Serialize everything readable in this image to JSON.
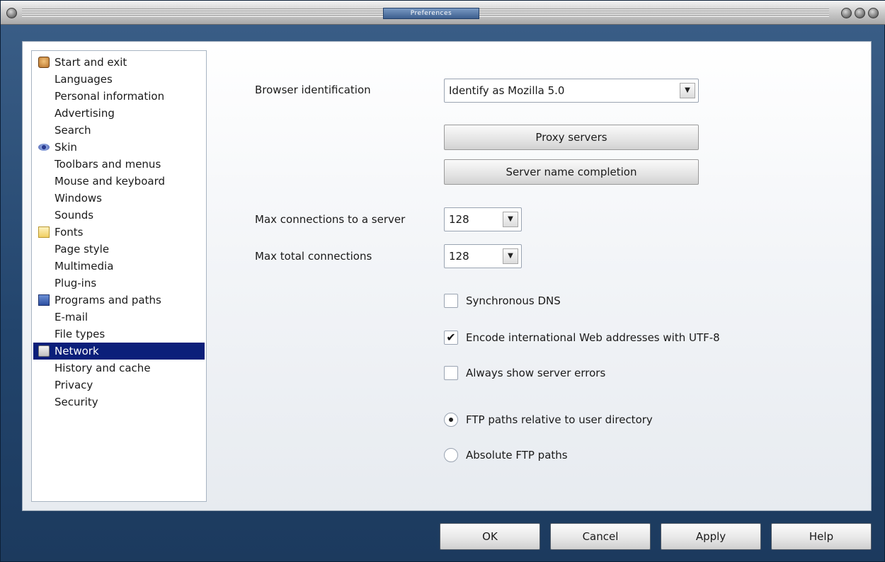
{
  "window": {
    "title": "Preferences"
  },
  "sidebar": {
    "items": [
      {
        "label": "Start and exit",
        "icon": "face-icon"
      },
      {
        "label": "Languages"
      },
      {
        "label": "Personal information"
      },
      {
        "label": "Advertising"
      },
      {
        "label": "Search"
      },
      {
        "label": "Skin",
        "icon": "eye-icon"
      },
      {
        "label": "Toolbars and menus"
      },
      {
        "label": "Mouse and keyboard"
      },
      {
        "label": "Windows"
      },
      {
        "label": "Sounds"
      },
      {
        "label": "Fonts",
        "icon": "folder-icon"
      },
      {
        "label": "Page style"
      },
      {
        "label": "Multimedia"
      },
      {
        "label": "Plug-ins"
      },
      {
        "label": "Programs and paths",
        "icon": "disk-icon"
      },
      {
        "label": "E-mail"
      },
      {
        "label": "File types"
      },
      {
        "label": "Network",
        "icon": "lock-icon",
        "selected": true
      },
      {
        "label": "History and cache"
      },
      {
        "label": "Privacy"
      },
      {
        "label": "Security"
      }
    ]
  },
  "network": {
    "browser_identification_label": "Browser identification",
    "browser_identification_value": "Identify as Mozilla 5.0",
    "proxy_servers_button": "Proxy servers",
    "server_name_completion_button": "Server name completion",
    "max_connections_server_label": "Max connections to a server",
    "max_connections_server_value": "128",
    "max_total_connections_label": "Max total connections",
    "max_total_connections_value": "128",
    "synchronous_dns_label": "Synchronous DNS",
    "synchronous_dns_checked": false,
    "encode_utf8_label": "Encode international Web addresses with UTF-8",
    "encode_utf8_checked": true,
    "always_show_errors_label": "Always show server errors",
    "always_show_errors_checked": false,
    "ftp_relative_label": "FTP paths relative to user directory",
    "ftp_absolute_label": "Absolute FTP paths",
    "ftp_selected": "relative"
  },
  "footer": {
    "ok_label": "OK",
    "cancel_label": "Cancel",
    "apply_label": "Apply",
    "help_label": "Help"
  },
  "colors": {
    "selection": "#0b1f7a",
    "frame": "#22446c"
  }
}
